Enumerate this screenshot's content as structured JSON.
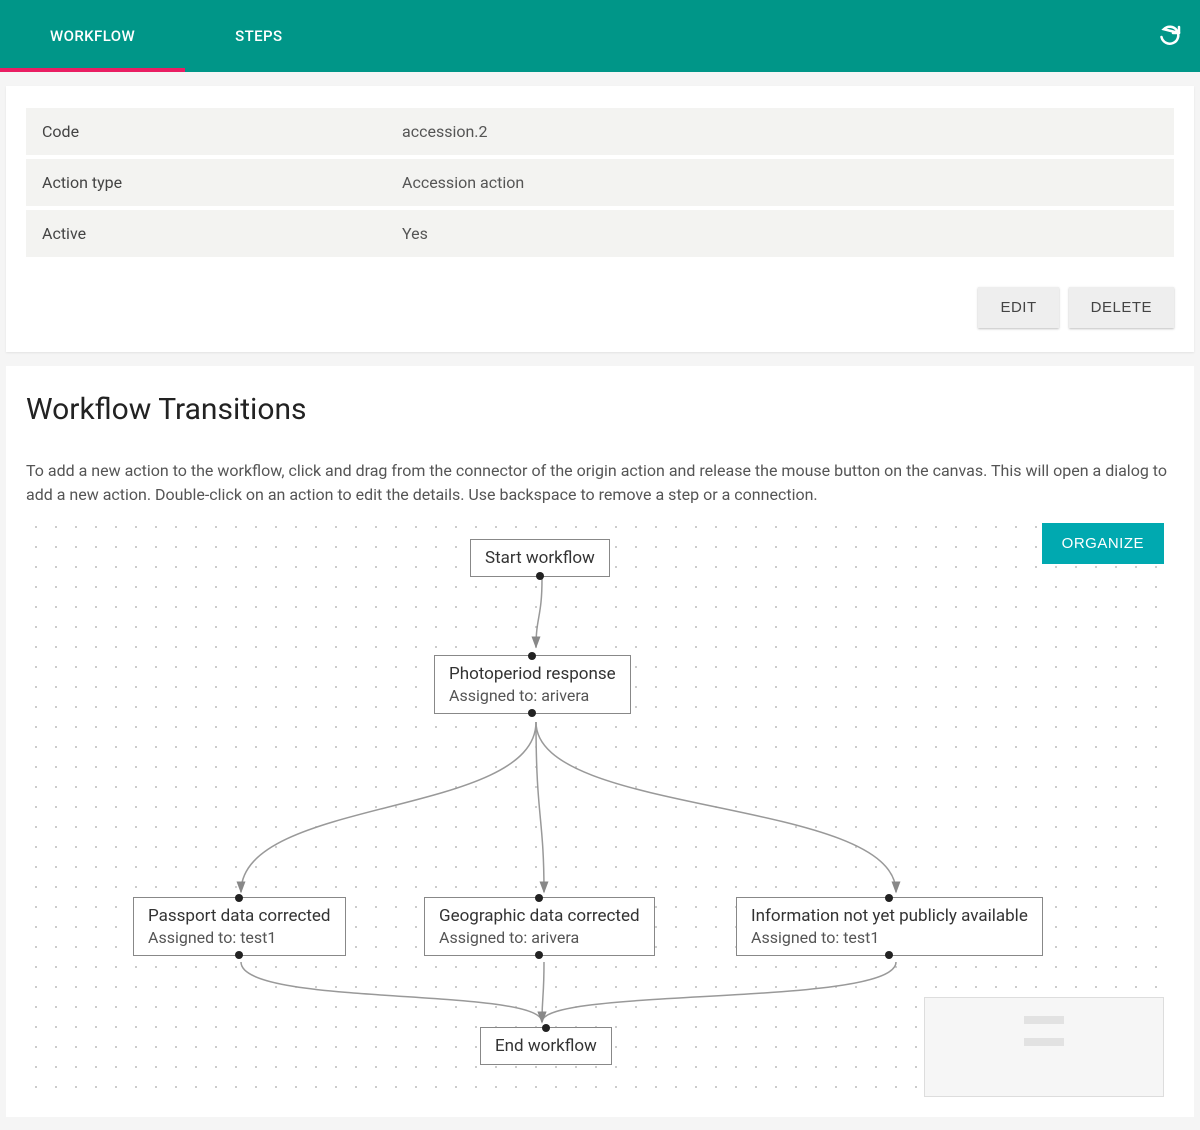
{
  "tabs": {
    "workflow": "WORKFLOW",
    "steps": "STEPS"
  },
  "info": {
    "code_label": "Code",
    "code_value": "accession.2",
    "action_type_label": "Action type",
    "action_type_value": "Accession action",
    "active_label": "Active",
    "active_value": "Yes"
  },
  "buttons": {
    "edit": "EDIT",
    "delete": "DELETE",
    "organize": "ORGANIZE"
  },
  "transitions": {
    "title": "Workflow Transitions",
    "help": "To add a new action to the workflow, click and drag from the connector of the origin action and release the mouse button on the canvas. This will open a dialog to add a new action. Double-click on an action to edit the details. Use backspace to remove a step or a connection."
  },
  "nodes": {
    "start": {
      "title": "Start workflow"
    },
    "photo": {
      "title": "Photoperiod response",
      "assigned": "Assigned to: arivera"
    },
    "passport": {
      "title": "Passport data corrected",
      "assigned": "Assigned to: test1"
    },
    "geo": {
      "title": "Geographic data corrected",
      "assigned": "Assigned to: arivera"
    },
    "info": {
      "title": "Information not yet publicly available",
      "assigned": "Assigned to: test1"
    },
    "end": {
      "title": "End workflow"
    }
  }
}
